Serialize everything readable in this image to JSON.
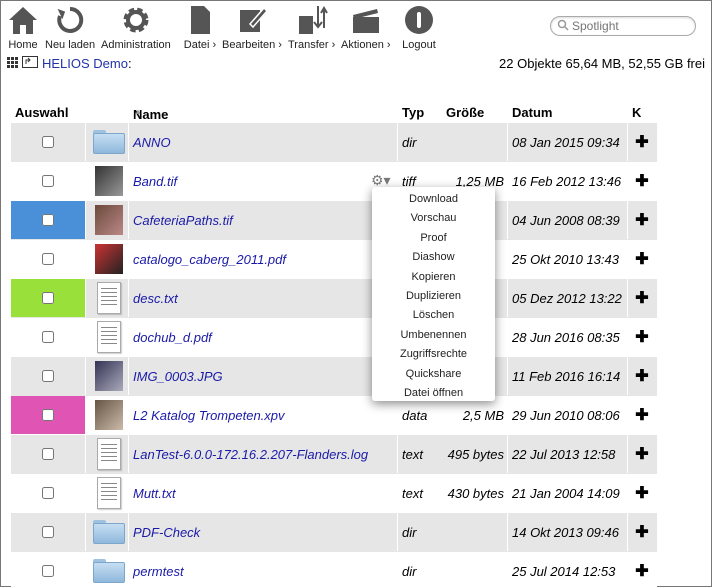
{
  "toolbar": {
    "home": "Home",
    "reload": "Neu laden",
    "admin": "Administration",
    "file": "Datei ›",
    "edit": "Bearbeiten ›",
    "transfer": "Transfer ›",
    "actions": "Aktionen ›",
    "logout": "Logout"
  },
  "search": {
    "placeholder": "Spotlight"
  },
  "path": {
    "volume": "HELIOS Demo",
    "suffix": ":"
  },
  "stats": "22 Objekte 65,64 MB, 52,55 GB frei",
  "columns": {
    "select": "Auswahl",
    "name": "Name",
    "type": "Typ",
    "size": "Größe",
    "date": "Datum",
    "k": "K"
  },
  "files": [
    {
      "name": "ANNO",
      "type": "dir",
      "size": "",
      "date": "08 Jan 2015 09:34",
      "thumb": "folder-icon",
      "label_color": ""
    },
    {
      "name": "Band.tif",
      "type": "tiff",
      "size": "1,25 MB",
      "date": "16 Feb 2012 13:46",
      "thumb": "photo",
      "label_color": ""
    },
    {
      "name": "CafeteriaPaths.tif",
      "type": "",
      "size": "",
      "date": "04 Jun 2008 08:39",
      "thumb": "photo",
      "label_color": "#4a90d9"
    },
    {
      "name": "catalogo_caberg_2011.pdf",
      "type": "",
      "size": "",
      "date": "25 Okt 2010 13:43",
      "thumb": "photo",
      "label_color": ""
    },
    {
      "name": "desc.txt",
      "type": "",
      "size": "",
      "date": "05 Dez 2012 13:22",
      "thumb": "document-icon",
      "label_color": "#99e03a"
    },
    {
      "name": "dochub_d.pdf",
      "type": "",
      "size": "",
      "date": "28 Jun 2016 08:35",
      "thumb": "document-icon",
      "label_color": ""
    },
    {
      "name": "IMG_0003.JPG",
      "type": "",
      "size": "",
      "date": "11 Feb 2016 16:14",
      "thumb": "photo",
      "label_color": ""
    },
    {
      "name": "L2 Katalog Trompeten.xpv",
      "type": "data",
      "size": "2,5 MB",
      "date": "29 Jun 2010 08:06",
      "thumb": "photo",
      "label_color": "#e054b4"
    },
    {
      "name": "LanTest-6.0.0-172.16.2.207-Flanders.log",
      "type": "text",
      "size": "495 bytes",
      "date": "22 Jul 2013 12:58",
      "thumb": "document-icon",
      "label_color": ""
    },
    {
      "name": "Mutt.txt",
      "type": "text",
      "size": "430 bytes",
      "date": "21 Jan 2004 14:09",
      "thumb": "document-icon",
      "label_color": ""
    },
    {
      "name": "PDF-Check",
      "type": "dir",
      "size": "",
      "date": "14 Okt 2013 09:46",
      "thumb": "folder-icon",
      "label_color": ""
    },
    {
      "name": "permtest",
      "type": "dir",
      "size": "",
      "date": "25 Jul 2014 12:53",
      "thumb": "folder-icon",
      "label_color": ""
    }
  ],
  "context_menu": [
    "Download",
    "Vorschau",
    "Proof",
    "Diashow",
    "Kopieren",
    "Duplizieren",
    "Löschen",
    "Umbenennen",
    "Zugriffsrechte",
    "Quickshare",
    "Datei öffnen"
  ]
}
